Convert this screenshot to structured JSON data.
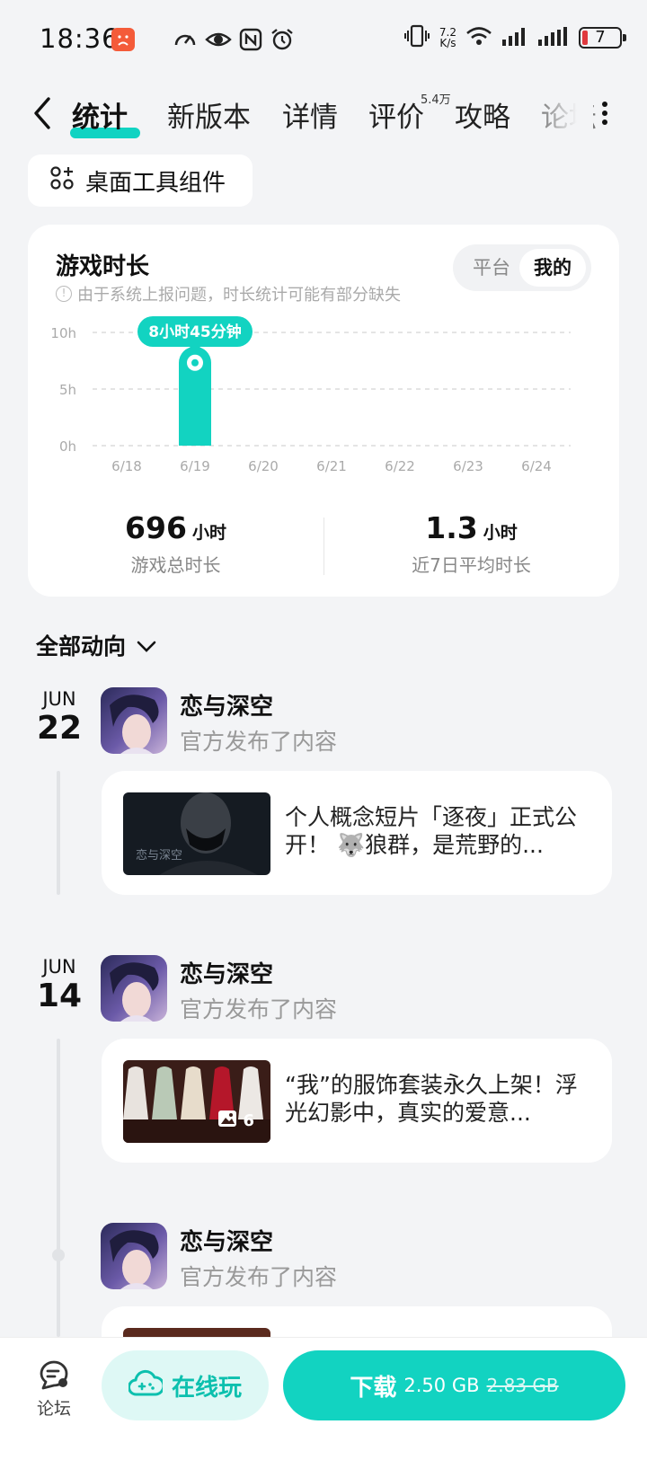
{
  "status_bar": {
    "time": "18:36",
    "net_speed_value": "7.2",
    "net_speed_unit": "K/s",
    "battery": "7",
    "icons": [
      "app-alert-icon",
      "speed-icon",
      "eye-icon",
      "nfc-icon",
      "alarm-icon",
      "vibrate-icon",
      "wifi-icon",
      "signal-icon",
      "signal-icon-2",
      "battery-icon"
    ]
  },
  "nav": {
    "tabs": [
      {
        "label": "统计",
        "active": true
      },
      {
        "label": "新版本"
      },
      {
        "label": "详情"
      },
      {
        "label": "评价"
      },
      {
        "label": "攻略"
      },
      {
        "label": "论坛"
      }
    ],
    "review_count": "5.4万"
  },
  "widget": {
    "label": "桌面工具组件"
  },
  "stats": {
    "title": "游戏时长",
    "note": "由于系统上报问题，时长统计可能有部分缺失",
    "toggle": {
      "platform": "平台",
      "mine": "我的",
      "selected": "mine"
    },
    "tooltip": "8小时45分钟",
    "total_hours": "696",
    "total_unit": "小时",
    "total_label": "游戏总时长",
    "avg_hours": "1.3",
    "avg_unit": "小时",
    "avg_label": "近7日平均时长"
  },
  "chart_data": {
    "type": "bar",
    "categories": [
      "6/18",
      "6/19",
      "6/20",
      "6/21",
      "6/22",
      "6/23",
      "6/24"
    ],
    "values": [
      0,
      8.75,
      0,
      0,
      0,
      0,
      0
    ],
    "y_ticks": [
      "0h",
      "5h",
      "10h"
    ],
    "ylim": [
      0,
      10
    ],
    "grid": true,
    "highlight_color": "#12d3c1"
  },
  "feed": {
    "filter_label": "全部动向",
    "posts": [
      {
        "month": "JUN",
        "day": "22",
        "author": "恋与深空",
        "action": "官方发布了内容",
        "text": "个人概念短片「逐夜」正式公开！ 🐺狼群，是荒野的..."
      },
      {
        "month": "JUN",
        "day": "14",
        "author": "恋与深空",
        "action": "官方发布了内容",
        "text": "“我”的服饰套装永久上架！浮光幻影中，真实的爱意...",
        "image_count": "6"
      },
      {
        "author": "恋与深空",
        "action": "官方发布了内容"
      }
    ]
  },
  "bottom": {
    "forum_label": "论坛",
    "online_label": "在线玩",
    "download_label": "下载",
    "download_size": "2.50 GB",
    "download_old_size": "2.83 GB"
  }
}
